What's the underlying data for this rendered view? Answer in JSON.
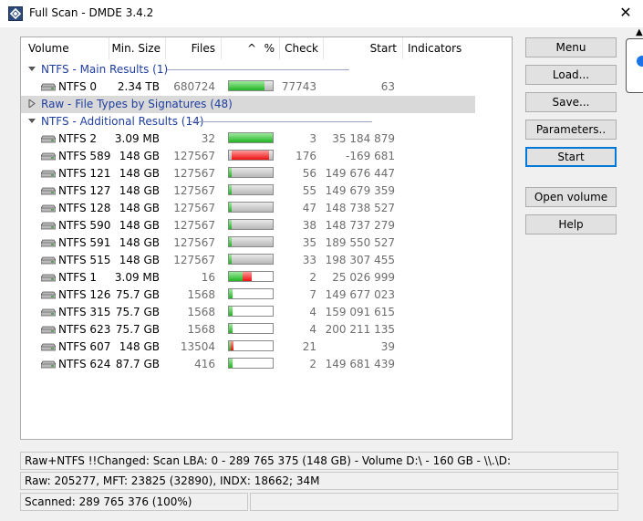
{
  "window": {
    "title": "Full Scan - DMDE 3.4.2",
    "close_glyph": "✕"
  },
  "columns": {
    "volume": "Volume",
    "min_size": "Min. Size",
    "files": "Files",
    "percent": "%",
    "check": "Check",
    "start": "Start",
    "indicators": "Indicators"
  },
  "groups": {
    "main": "NTFS - Main Results (1)",
    "raw": "Raw - File Types by Signatures (48)",
    "additional": "NTFS - Additional Results (14)"
  },
  "main_rows": [
    {
      "name": "NTFS 0",
      "size": "2.34 TB",
      "files": "680724",
      "check": "77743",
      "start": "63",
      "bar": [
        {
          "c": "g",
          "w": 0.82
        },
        {
          "c": "s",
          "w": 0.18
        }
      ]
    }
  ],
  "additional_rows": [
    {
      "name": "NTFS 2",
      "size": "3.09 MB",
      "files": "32",
      "check": "3",
      "start": "35 184 879",
      "bar": [
        {
          "c": "g",
          "w": 1.0
        }
      ]
    },
    {
      "name": "NTFS 589",
      "size": "148 GB",
      "files": "127567",
      "check": "176",
      "start": "-169 681",
      "bar": [
        {
          "c": "s",
          "w": 0.06
        },
        {
          "c": "r",
          "w": 0.86
        },
        {
          "c": "s",
          "w": 0.08
        }
      ]
    },
    {
      "name": "NTFS 121",
      "size": "148 GB",
      "files": "127567",
      "check": "56",
      "start": "149 676 447",
      "bar": [
        {
          "c": "g",
          "w": 0.06
        },
        {
          "c": "s",
          "w": 0.94
        }
      ]
    },
    {
      "name": "NTFS 127",
      "size": "148 GB",
      "files": "127567",
      "check": "55",
      "start": "149 679 359",
      "bar": [
        {
          "c": "g",
          "w": 0.06
        },
        {
          "c": "s",
          "w": 0.94
        }
      ]
    },
    {
      "name": "NTFS 128",
      "size": "148 GB",
      "files": "127567",
      "check": "47",
      "start": "148 738 527",
      "bar": [
        {
          "c": "g",
          "w": 0.06
        },
        {
          "c": "s",
          "w": 0.94
        }
      ]
    },
    {
      "name": "NTFS 590",
      "size": "148 GB",
      "files": "127567",
      "check": "38",
      "start": "148 737 279",
      "bar": [
        {
          "c": "g",
          "w": 0.06
        },
        {
          "c": "s",
          "w": 0.94
        }
      ]
    },
    {
      "name": "NTFS 591",
      "size": "148 GB",
      "files": "127567",
      "check": "35",
      "start": "189 550 527",
      "bar": [
        {
          "c": "g",
          "w": 0.06
        },
        {
          "c": "s",
          "w": 0.94
        }
      ]
    },
    {
      "name": "NTFS 515",
      "size": "148 GB",
      "files": "127567",
      "check": "33",
      "start": "198 307 455",
      "bar": [
        {
          "c": "g",
          "w": 0.06
        },
        {
          "c": "s",
          "w": 0.94
        }
      ]
    },
    {
      "name": "NTFS 1",
      "size": "3.09 MB",
      "files": "16",
      "check": "2",
      "start": "25 026 999",
      "bar": [
        {
          "c": "g",
          "w": 0.32
        },
        {
          "c": "r",
          "w": 0.2
        }
      ]
    },
    {
      "name": "NTFS 126",
      "size": "75.7 GB",
      "files": "1568",
      "check": "7",
      "start": "149 677 023",
      "bar": [
        {
          "c": "g",
          "w": 0.08
        }
      ]
    },
    {
      "name": "NTFS 315",
      "size": "75.7 GB",
      "files": "1568",
      "check": "4",
      "start": "159 091 615",
      "bar": [
        {
          "c": "g",
          "w": 0.08
        }
      ]
    },
    {
      "name": "NTFS 623",
      "size": "75.7 GB",
      "files": "1568",
      "check": "4",
      "start": "200 211 135",
      "bar": [
        {
          "c": "g",
          "w": 0.08
        }
      ]
    },
    {
      "name": "NTFS 607",
      "size": "148 GB",
      "files": "13504",
      "check": "21",
      "start": "39",
      "bar": [
        {
          "c": "g",
          "w": 0.04
        },
        {
          "c": "r",
          "w": 0.06
        }
      ]
    },
    {
      "name": "NTFS 624",
      "size": "87.7 GB",
      "files": "416",
      "check": "2",
      "start": "149 681 439",
      "bar": [
        {
          "c": "g",
          "w": 0.08
        }
      ]
    }
  ],
  "buttons": {
    "menu": "Menu",
    "load": "Load...",
    "save": "Save...",
    "parameters": "Parameters..",
    "start": "Start",
    "open_volume": "Open volume",
    "help": "Help"
  },
  "status": {
    "line1": "Raw+NTFS !!Changed: Scan LBA: 0 - 289 765 375 (148 GB) - Volume D:\\ - 160 GB - \\\\.\\D:",
    "line2": "Raw: 205277, MFT: 23825 (32890), INDX: 18662; 34M",
    "line3": "Scanned: 289 765 376 (100%)"
  },
  "colors": {
    "accent": "#0078d7",
    "group_text": "#1f3ea0",
    "bar_green": "#21b521",
    "bar_red": "#e11111"
  }
}
